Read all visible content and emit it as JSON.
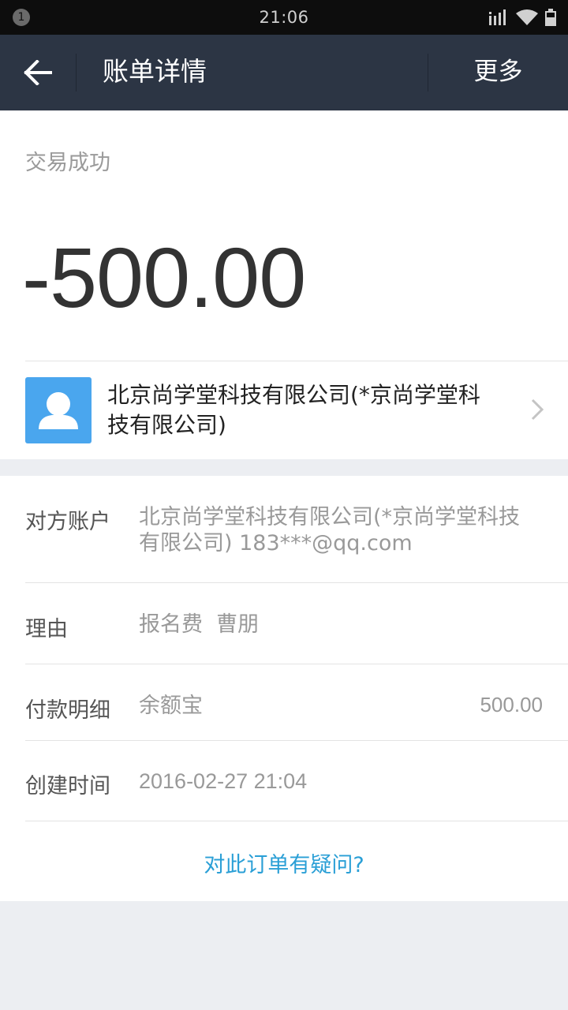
{
  "status_bar": {
    "notification_count": "1",
    "time": "21:06",
    "icons": [
      "signal-icon",
      "wifi-icon",
      "battery-icon"
    ]
  },
  "title_bar": {
    "back_icon": "back-arrow-icon",
    "title": "账单详情",
    "more_label": "更多"
  },
  "summary": {
    "status": "交易成功",
    "amount": "-500.00"
  },
  "merchant": {
    "avatar_icon": "user-avatar-icon",
    "name": "北京尚学堂科技有限公司(*京尚学堂科技有限公司)",
    "chevron_icon": "chevron-right-icon"
  },
  "details": {
    "account_label": "对方账户",
    "account_value": "北京尚学堂科技有限公司(*京尚学堂科技有限公司) 183***@qq.com",
    "reason_label": "理由",
    "reason_value": "报名费  曹朋",
    "payment_label": "付款明细",
    "payment_method": "余额宝",
    "payment_amount": "500.00",
    "created_label": "创建时间",
    "created_value": "2016-02-27 21:04"
  },
  "question_link": "对此订单有疑问?",
  "colors": {
    "title_bar": "#2c3544",
    "avatar": "#4aa6ee",
    "link": "#2a9fd6",
    "page_bg": "#eceef2"
  }
}
